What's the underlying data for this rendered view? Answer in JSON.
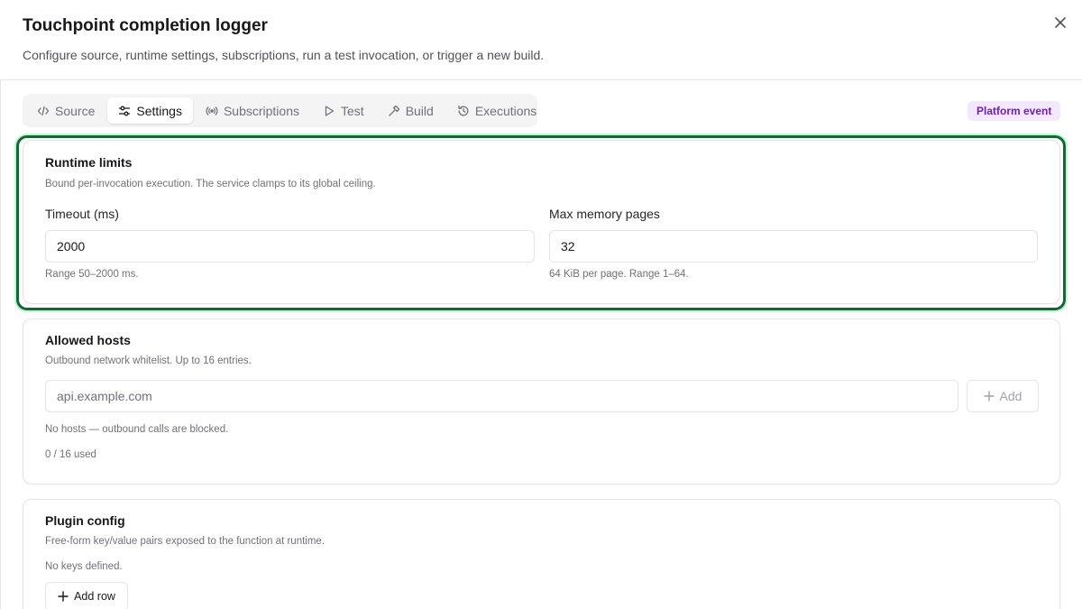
{
  "dialog": {
    "title": "Touchpoint completion logger",
    "subtitle": "Configure source, runtime settings, subscriptions, run a test invocation, or trigger a new build."
  },
  "tabs": [
    {
      "label": "Source",
      "icon": "code-icon",
      "active": false
    },
    {
      "label": "Settings",
      "icon": "sliders-icon",
      "active": true
    },
    {
      "label": "Subscriptions",
      "icon": "broadcast-icon",
      "active": false
    },
    {
      "label": "Test",
      "icon": "play-icon",
      "active": false
    },
    {
      "label": "Build",
      "icon": "hammer-icon",
      "active": false
    },
    {
      "label": "Executions",
      "icon": "history-icon",
      "active": false
    }
  ],
  "badge": "Platform event",
  "runtime_limits": {
    "title": "Runtime limits",
    "description": "Bound per-invocation execution. The service clamps to its global ceiling.",
    "timeout": {
      "label": "Timeout (ms)",
      "value": "2000",
      "hint": "Range 50–2000 ms."
    },
    "memory": {
      "label": "Max memory pages",
      "value": "32",
      "hint": "64 KiB per page. Range 1–64."
    }
  },
  "allowed_hosts": {
    "title": "Allowed hosts",
    "description": "Outbound network whitelist. Up to 16 entries.",
    "input_placeholder": "api.example.com",
    "add_label": "Add",
    "empty_text": "No hosts — outbound calls are blocked.",
    "usage": "0 / 16 used"
  },
  "plugin_config": {
    "title": "Plugin config",
    "description": "Free-form key/value pairs exposed to the function at runtime.",
    "empty_text": "No keys defined.",
    "add_row_label": "Add row"
  },
  "colors": {
    "accent_highlight": "#166534",
    "badge_bg": "#f3e8ff",
    "badge_text": "#6b21a8"
  }
}
